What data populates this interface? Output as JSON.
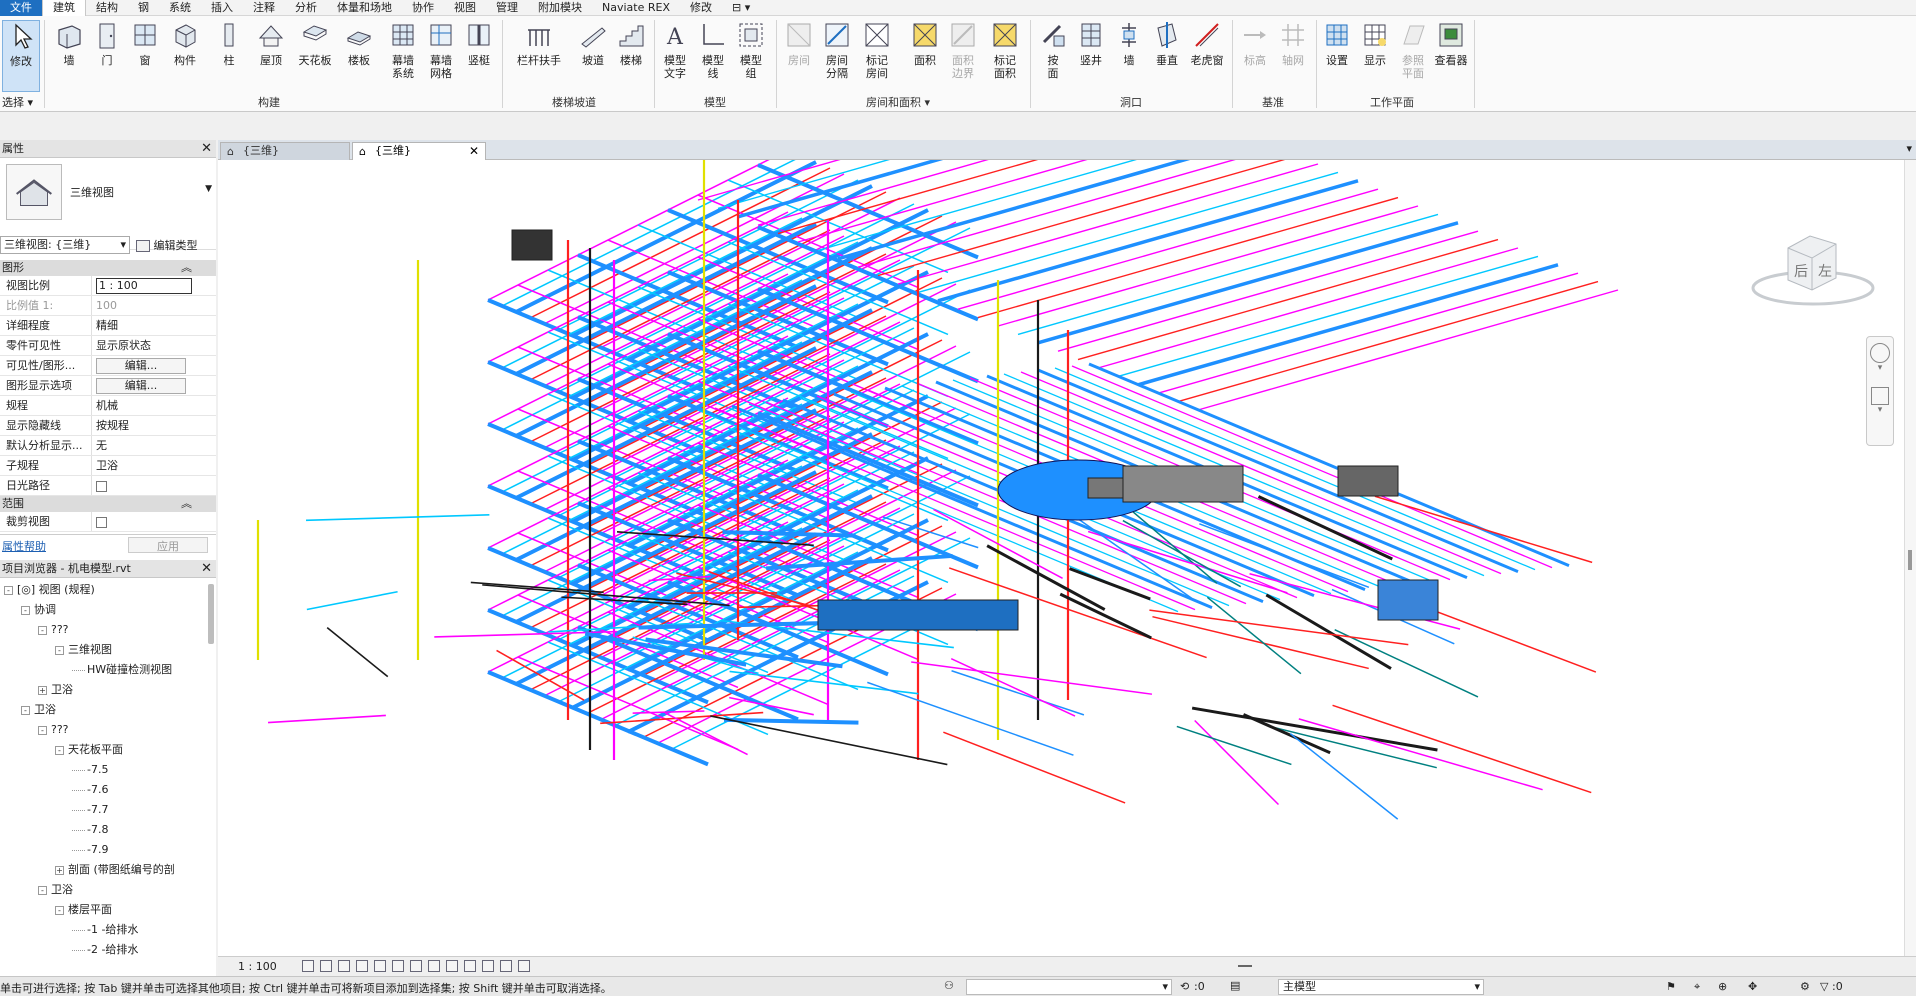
{
  "menu": {
    "tabs": [
      "文件",
      "建筑",
      "结构",
      "钢",
      "系统",
      "插入",
      "注释",
      "分析",
      "体量和场地",
      "协作",
      "视图",
      "管理",
      "附加模块",
      "Naviate REX",
      "修改"
    ],
    "active_index": 1
  },
  "ribbon": {
    "select_label": "选择",
    "panels": {
      "build": "构建",
      "stairs": "楼梯坡道",
      "model": "模型",
      "room": "房间和面积",
      "opening": "洞口",
      "datum": "基准",
      "workplane": "工作平面"
    },
    "buttons": {
      "modify": "修改",
      "wall": "墙",
      "door": "门",
      "window": "窗",
      "component": "构件",
      "column": "柱",
      "roof": "屋顶",
      "ceiling": "天花板",
      "floor": "楼板",
      "curtain_system": "幕墙\n系统",
      "curtain_grid": "幕墙\n网格",
      "mullion": "竖梃",
      "railing": "栏杆扶手",
      "ramp": "坡道",
      "stair": "楼梯",
      "model_text": "模型\n文字",
      "model_line": "模型\n线",
      "model_group": "模型\n组",
      "room": "房间",
      "room_separator": "房间\n分隔",
      "tag_room": "标记\n房间",
      "area": "面积",
      "area_boundary": "面积\n边界",
      "tag_area": "标记\n面积",
      "by_face": "按\n面",
      "shaft": "竖井",
      "wall_opening": "墙",
      "vertical": "垂直",
      "dormer": "老虎窗",
      "level": "标高",
      "grid": "轴网",
      "set": "设置",
      "show": "显示",
      "ref_plane": "参照\n平面",
      "viewer": "查看器"
    }
  },
  "properties": {
    "title": "属性",
    "type_name": "三维视图",
    "view_selector": "三维视图: {三维}",
    "edit_type": "编辑类型",
    "group_graphics": "图形",
    "group_extents": "范围",
    "rows": [
      {
        "k": "视图比例",
        "v": "1 : 100"
      },
      {
        "k": "比例值 1:",
        "v": "100"
      },
      {
        "k": "详细程度",
        "v": "精细"
      },
      {
        "k": "零件可见性",
        "v": "显示原状态"
      },
      {
        "k": "可见性/图形...",
        "v": "编辑..."
      },
      {
        "k": "图形显示选项",
        "v": "编辑..."
      },
      {
        "k": "规程",
        "v": "机械"
      },
      {
        "k": "显示隐藏线",
        "v": "按规程"
      },
      {
        "k": "默认分析显示...",
        "v": "无"
      },
      {
        "k": "子规程",
        "v": "卫浴"
      },
      {
        "k": "日光路径",
        "v": ""
      }
    ],
    "crop_view": "裁剪视图",
    "help": "属性帮助",
    "apply": "应用"
  },
  "browser": {
    "title": "项目浏览器 - 机电模型.rvt",
    "nodes": [
      {
        "level": 0,
        "toggle": "-",
        "label": "[◎] 视图 (规程)"
      },
      {
        "level": 1,
        "toggle": "-",
        "label": "协调"
      },
      {
        "level": 2,
        "toggle": "-",
        "label": "???"
      },
      {
        "level": 3,
        "toggle": "-",
        "label": "三维视图"
      },
      {
        "level": 4,
        "toggle": "",
        "label": "HW碰撞检测视图"
      },
      {
        "level": 2,
        "toggle": "+",
        "label": "卫浴"
      },
      {
        "level": 1,
        "toggle": "-",
        "label": "卫浴"
      },
      {
        "level": 2,
        "toggle": "-",
        "label": "???"
      },
      {
        "level": 3,
        "toggle": "-",
        "label": "天花板平面"
      },
      {
        "level": 4,
        "toggle": "",
        "label": "-7.5"
      },
      {
        "level": 4,
        "toggle": "",
        "label": "-7.6"
      },
      {
        "level": 4,
        "toggle": "",
        "label": "-7.7"
      },
      {
        "level": 4,
        "toggle": "",
        "label": "-7.8"
      },
      {
        "level": 4,
        "toggle": "",
        "label": "-7.9"
      },
      {
        "level": 3,
        "toggle": "+",
        "label": "剖面 (带图纸编号的剖"
      },
      {
        "level": 2,
        "toggle": "-",
        "label": "卫浴"
      },
      {
        "level": 3,
        "toggle": "-",
        "label": "楼层平面"
      },
      {
        "level": 4,
        "toggle": "",
        "label": "-1 -给排水"
      },
      {
        "level": 4,
        "toggle": "",
        "label": "-2 -给排水"
      }
    ]
  },
  "viewtabs": [
    {
      "label": "{三维}",
      "active": false
    },
    {
      "label": "{三维}",
      "active": true
    }
  ],
  "viewcube": {
    "back": "后",
    "left": "左"
  },
  "viewcontrol": {
    "scale": "1 : 100"
  },
  "status": {
    "message": "单击可进行选择; 按 Tab 键并单击可选择其他项目; 按 Ctrl 键并单击可将新项目添加到选择集; 按 Shift 键并单击可取消选择。",
    "rotation": ":0",
    "model": "主模型",
    "filter": ":0"
  },
  "colors": {
    "accent": "#1e6fc1",
    "pipe_magenta": "#ff00ff",
    "pipe_cyan": "#00c8ff",
    "pipe_blue": "#1e90ff",
    "pipe_red": "#ff2020",
    "pipe_yellow": "#e0e000",
    "pipe_dark": "#1a1a1a",
    "pipe_teal": "#008080"
  }
}
